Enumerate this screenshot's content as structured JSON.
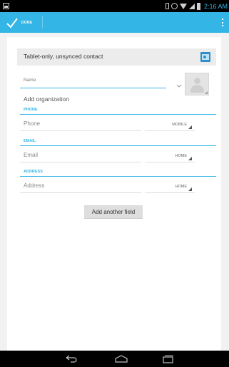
{
  "status_bar": {
    "time": "2:16 AM",
    "icons": [
      "gallery-icon",
      "vibrate-icon",
      "alarm-icon",
      "wifi-icon",
      "signal-icon",
      "battery-icon"
    ]
  },
  "action_bar": {
    "done_label": "DONE",
    "accent_color": "#33b5e5",
    "icons": [
      "check-icon",
      "overflow-menu-icon"
    ]
  },
  "editor": {
    "account_label": "Tablet-only, unsynced contact",
    "account_icon": "contact-card-icon",
    "name_placeholder": "Name",
    "organization_link": "Add organization",
    "sections": {
      "phone": {
        "header": "PHONE",
        "placeholder": "Phone",
        "type": "MOBILE"
      },
      "email": {
        "header": "EMAIL",
        "placeholder": "Email",
        "type": "HOME"
      },
      "address": {
        "header": "ADDRESS",
        "placeholder": "Address",
        "type": "HOME"
      }
    },
    "add_field_label": "Add another field"
  },
  "nav_bar": {
    "icons": [
      "back-icon",
      "home-icon",
      "recents-icon"
    ]
  }
}
